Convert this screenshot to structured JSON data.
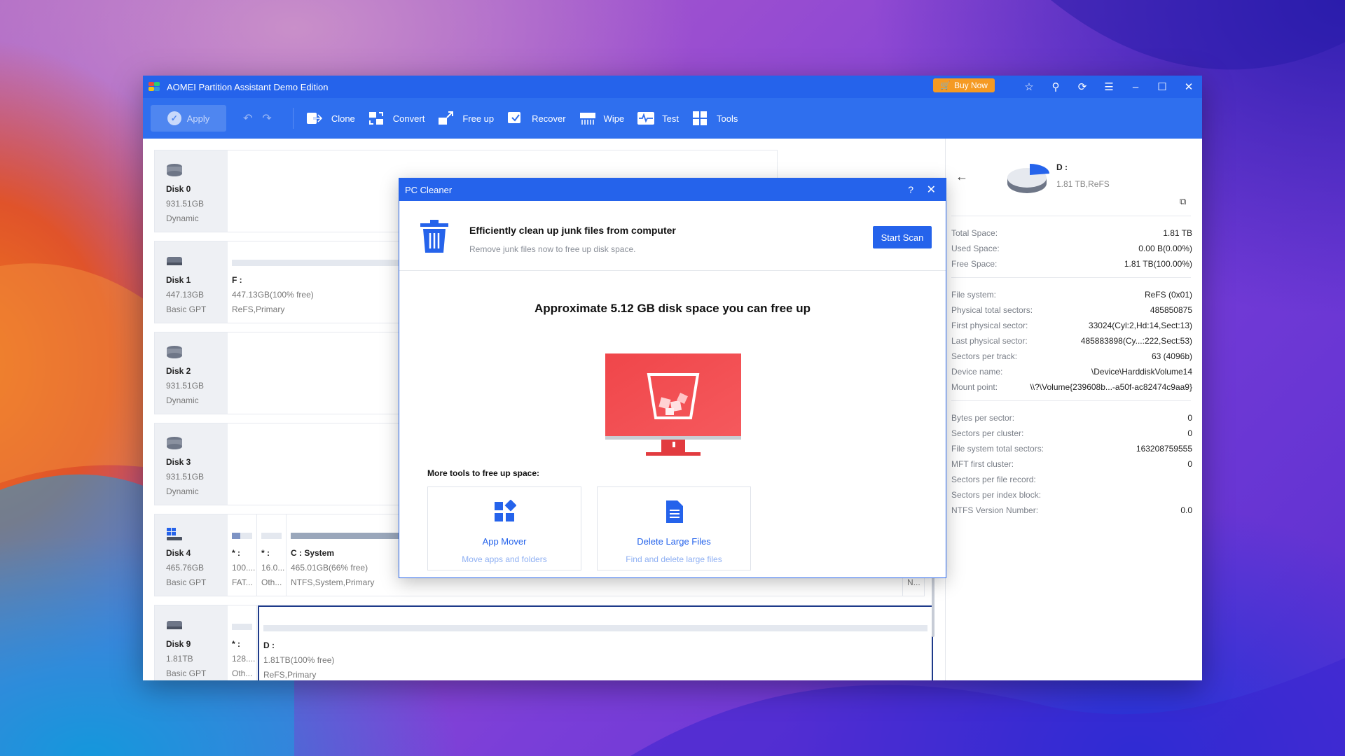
{
  "window": {
    "title": "AOMEI Partition Assistant Demo Edition",
    "buy_now": "Buy Now"
  },
  "toolbar": {
    "apply": "Apply",
    "tools": [
      {
        "label": "Clone",
        "icon": "clone-icon"
      },
      {
        "label": "Convert",
        "icon": "convert-icon"
      },
      {
        "label": "Free up",
        "icon": "free-up-icon"
      },
      {
        "label": "Recover",
        "icon": "recover-icon"
      },
      {
        "label": "Wipe",
        "icon": "wipe-icon"
      },
      {
        "label": "Test",
        "icon": "test-icon"
      },
      {
        "label": "Tools",
        "icon": "tools-icon"
      }
    ]
  },
  "disks": [
    {
      "name": "Disk 0",
      "size": "931.51GB",
      "type": "Dynamic"
    },
    {
      "name": "Disk 1",
      "size": "447.13GB",
      "type": "Basic GPT",
      "partitions": [
        {
          "name": "F :",
          "size": "447.13GB(100% free)",
          "type": "ReFS,Primary"
        }
      ]
    },
    {
      "name": "Disk 2",
      "size": "931.51GB",
      "type": "Dynamic"
    },
    {
      "name": "Disk 3",
      "size": "931.51GB",
      "type": "Dynamic"
    },
    {
      "name": "Disk 4",
      "size": "465.76GB",
      "type": "Basic GPT",
      "partitions": [
        {
          "name": "* :",
          "size": "100....",
          "type": "FAT..."
        },
        {
          "name": "* :",
          "size": "16.0...",
          "type": "Oth..."
        },
        {
          "name": "C : System",
          "size": "465.01GB(66% free)",
          "type": "NTFS,System,Primary"
        },
        {
          "name": "",
          "size": "",
          "type": "N..."
        }
      ]
    },
    {
      "name": "Disk 9",
      "size": "1.81TB",
      "type": "Basic GPT",
      "partitions": [
        {
          "name": "* :",
          "size": "128....",
          "type": "Oth..."
        },
        {
          "name": "D :",
          "size": "1.81TB(100% free)",
          "type": "ReFS,Primary"
        }
      ]
    }
  ],
  "details": {
    "drive": "D :",
    "summary": "1.81 TB,ReFS",
    "group1": [
      {
        "k": "Total Space:",
        "v": "1.81 TB"
      },
      {
        "k": "Used Space:",
        "v": "0.00 B(0.00%)"
      },
      {
        "k": "Free Space:",
        "v": "1.81 TB(100.00%)"
      }
    ],
    "group2": [
      {
        "k": "File system:",
        "v": "ReFS (0x01)"
      },
      {
        "k": "Physical total sectors:",
        "v": "485850875"
      },
      {
        "k": "First physical sector:",
        "v": "33024(Cyl:2,Hd:14,Sect:13)"
      },
      {
        "k": "Last physical sector:",
        "v": "485883898(Cy...:222,Sect:53)"
      },
      {
        "k": "Sectors per track:",
        "v": "63 (4096b)"
      },
      {
        "k": "Device name:",
        "v": "\\Device\\HarddiskVolume14"
      },
      {
        "k": "Mount point:",
        "v": "\\\\?\\Volume{239608b...-a50f-ac82474c9aa9}"
      }
    ],
    "group3": [
      {
        "k": "Bytes per sector:",
        "v": "0"
      },
      {
        "k": "Sectors per cluster:",
        "v": "0"
      },
      {
        "k": "File system total sectors:",
        "v": "163208759555"
      },
      {
        "k": "MFT first cluster:",
        "v": "0"
      },
      {
        "k": "Sectors per file record:",
        "v": ""
      },
      {
        "k": "Sectors per index block:",
        "v": ""
      },
      {
        "k": "NTFS Version Number:",
        "v": "0.0"
      }
    ]
  },
  "dialog": {
    "title": "PC Cleaner",
    "help": "?",
    "close": "✕",
    "heading": "Efficiently clean up junk files from computer",
    "subheading": "Remove junk files now to free up disk space.",
    "start_scan": "Start Scan",
    "approx": "Approximate 5.12 GB disk space you can free up",
    "more_tools": "More tools to free up space:",
    "cards": [
      {
        "title": "App Mover",
        "desc": "Move apps and folders"
      },
      {
        "title": "Delete Large Files",
        "desc": "Find and delete large files"
      }
    ]
  },
  "colors": {
    "accent": "#2563eb",
    "buy_now": "#f59a23",
    "monitor": "#f0464a"
  }
}
